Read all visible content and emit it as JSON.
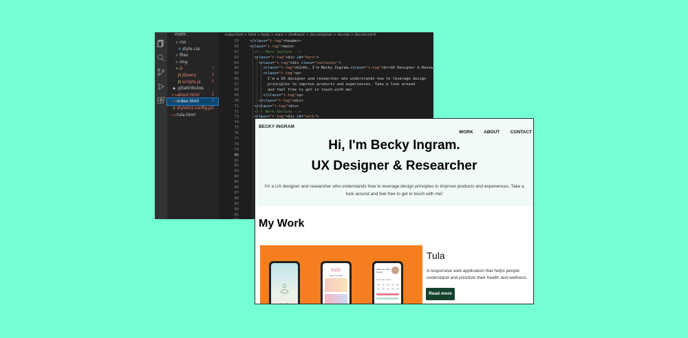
{
  "editor": {
    "explorer_title": "PORTF...",
    "breadcrumb": "index.html > html > body > main > div#work > div.container > div.row > div.col-md-6",
    "files": [
      {
        "label": "css",
        "type": "folder",
        "color": "#cccccc",
        "icon": "v",
        "indent": 10,
        "badge": ""
      },
      {
        "label": "style.css",
        "type": "css",
        "color": "#cccccc",
        "icon": "#",
        "indent": 14,
        "badge": ""
      },
      {
        "label": "files",
        "type": "folder",
        "color": "#cccccc",
        "icon": ">",
        "indent": 10,
        "badge": ""
      },
      {
        "label": "img",
        "type": "folder",
        "color": "#cccccc",
        "icon": ">",
        "indent": 10,
        "badge": ""
      },
      {
        "label": "js",
        "type": "folder",
        "color": "#f48771",
        "icon": "v",
        "indent": 10,
        "badge": "•"
      },
      {
        "label": "JQuery",
        "type": "js",
        "color": "#f48771",
        "icon": "JS",
        "indent": 14,
        "badge": "1"
      },
      {
        "label": "scripts.js",
        "type": "js",
        "color": "#f48771",
        "icon": "JS",
        "indent": 14,
        "badge": "1"
      },
      {
        "label": ".gitattributes",
        "type": "git",
        "color": "#cccccc",
        "icon": "◆",
        "indent": 6,
        "badge": ""
      },
      {
        "label": "about.html",
        "type": "html",
        "color": "#f48771",
        "icon": "<>",
        "indent": 6,
        "badge": "1"
      },
      {
        "label": "index.html",
        "type": "html",
        "color": "#ffffff",
        "icon": "<>",
        "indent": 6,
        "badge": "1",
        "active": true
      },
      {
        "label": "stylelint.config.js",
        "type": "js",
        "color": "#f48771",
        "icon": "S",
        "indent": 6,
        "badge": "1"
      },
      {
        "label": "tula.html",
        "type": "html",
        "color": "#cccccc",
        "icon": "<>",
        "indent": 6,
        "badge": ""
      }
    ],
    "line_numbers": [
      "59",
      "60",
      "61",
      "62",
      "63",
      "64",
      "65",
      "66",
      "67",
      "68",
      "69",
      "70",
      "71",
      "72",
      "73",
      "74",
      "75",
      "76",
      "77",
      "78",
      "79",
      "80",
      "81",
      "82",
      "83",
      "84",
      "85",
      "86",
      "87",
      "88",
      "89",
      "90",
      "91",
      "92"
    ],
    "current_line": "80",
    "code_lines": [
      "</header>",
      "<main>",
      "  <!-- Hero Section -->",
      "  <div id=\"hero\">",
      "    <div class=\"container\">",
      "      <h1>Hi, I'm Becky Ingram.<br>UX Designer & Researcher</h1>",
      "      <p>",
      "        I'm a UX designer and researcher who understands how to leverage design",
      "        principles to improve products and experiences. Take a look around",
      "        and feel free to get in touch with me!",
      "      </p>",
      "    </div>",
      "  </div>",
      "  <!-- Work Section -->",
      "  <div id=\"work\">"
    ]
  },
  "site": {
    "brand": "BECKY INGRAM",
    "nav": [
      "WORK",
      "ABOUT",
      "CONTACT"
    ],
    "hero": {
      "line1": "Hi, I'm Becky Ingram.",
      "line2": "UX Designer & Researcher",
      "intro": "I'm a UX designer and researcher who understands how to leverage design principles to improve products and experiences. Take a look around and feel free to get in touch with me!"
    },
    "work_title": "My Work",
    "project": {
      "title": "Tula",
      "description": "A responsive web application that helps people understand and prioritize their health and wellness.",
      "button": "Read more",
      "image_bg": "#f57f1f",
      "phone_texts": {
        "phone1": "tula",
        "phone2_title": "tula",
        "phone2_sub": "Start Your Day",
        "phone3_title": "Welcome back, Nessie",
        "phone3_date": "December 2021"
      }
    }
  },
  "colors": {
    "background": "#74fed3",
    "hero_bg": "#f0fbf7",
    "button": "#15422d",
    "editor_bg": "#1e1e1e"
  }
}
